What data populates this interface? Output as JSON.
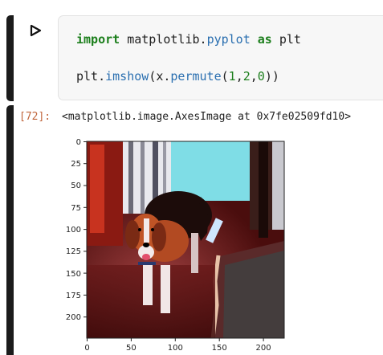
{
  "cell": {
    "code_line1": {
      "kw1": "import",
      "text1": " matplotlib",
      "dot": ".",
      "mod": "pyplot",
      "text2": " ",
      "kw2": "as",
      "text3": " plt"
    },
    "code_line2": {
      "obj": "plt",
      "dot": ".",
      "fn": "imshow",
      "p1": "(x.",
      "method": "permute",
      "p2": "(",
      "a1": "1",
      "c1": ",",
      "a2": "2",
      "c2": ",",
      "a3": "0",
      "p3": "))"
    }
  },
  "output": {
    "prompt": "[72]:",
    "repr": "<matplotlib.image.AxesImage at 0x7fe02509fd10>"
  },
  "chart_data": {
    "type": "image",
    "xticks": [
      0,
      50,
      100,
      150,
      200
    ],
    "yticks": [
      0,
      25,
      50,
      75,
      100,
      125,
      150,
      175,
      200
    ],
    "xlim": [
      0,
      224
    ],
    "ylim": [
      224,
      0
    ],
    "image_subject": "beagle-dog-photo"
  },
  "colors": {
    "prompt": "#c0653b",
    "keyword": "#1b7e1b",
    "module": "#2a6fb0",
    "cell_bar": "#1b1b1b"
  }
}
